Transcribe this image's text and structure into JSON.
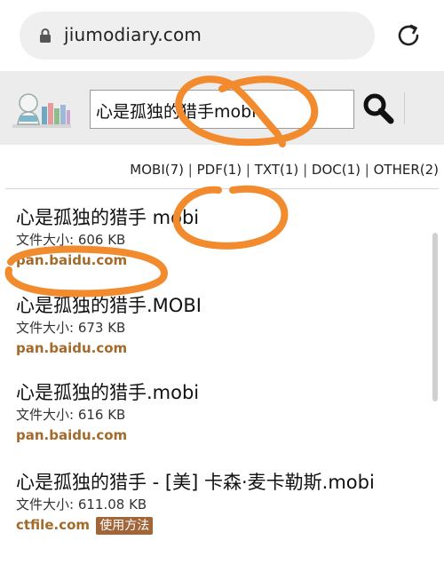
{
  "browser": {
    "url": "jiumodiary.com",
    "lock_icon": "lock-icon",
    "reload_icon": "reload-icon"
  },
  "header": {
    "logo_icon": "reading-child-books-logo",
    "search_value": "心是孤独的猎手mobi",
    "search_icon": "magnifier-icon"
  },
  "filters": [
    {
      "label": "MOBI(7)"
    },
    {
      "label": "PDF(1)"
    },
    {
      "label": "TXT(1)"
    },
    {
      "label": "DOC(1)"
    },
    {
      "label": "OTHER(2)"
    }
  ],
  "results": [
    {
      "title": "心是孤独的猎手 mobi",
      "size": "文件大小: 606 KB",
      "host": "pan.baidu.com"
    },
    {
      "title": "心是孤独的猎手.MOBI",
      "size": "文件大小: 673 KB",
      "host": "pan.baidu.com"
    },
    {
      "title": "心是孤独的猎手.mobi",
      "size": "文件大小: 616 KB",
      "host": "pan.baidu.com"
    },
    {
      "title": "心是孤独的猎手 - [美] 卡森·麦卡勒斯.mobi",
      "size": "文件大小: 611.08 KB",
      "host": "ctfile.com",
      "badge": "使用方法"
    }
  ],
  "colors": {
    "annotation": "#f28a2e",
    "host_link": "#a36a2a",
    "badge_bg": "#a0663a",
    "header_bg": "#ececec"
  }
}
